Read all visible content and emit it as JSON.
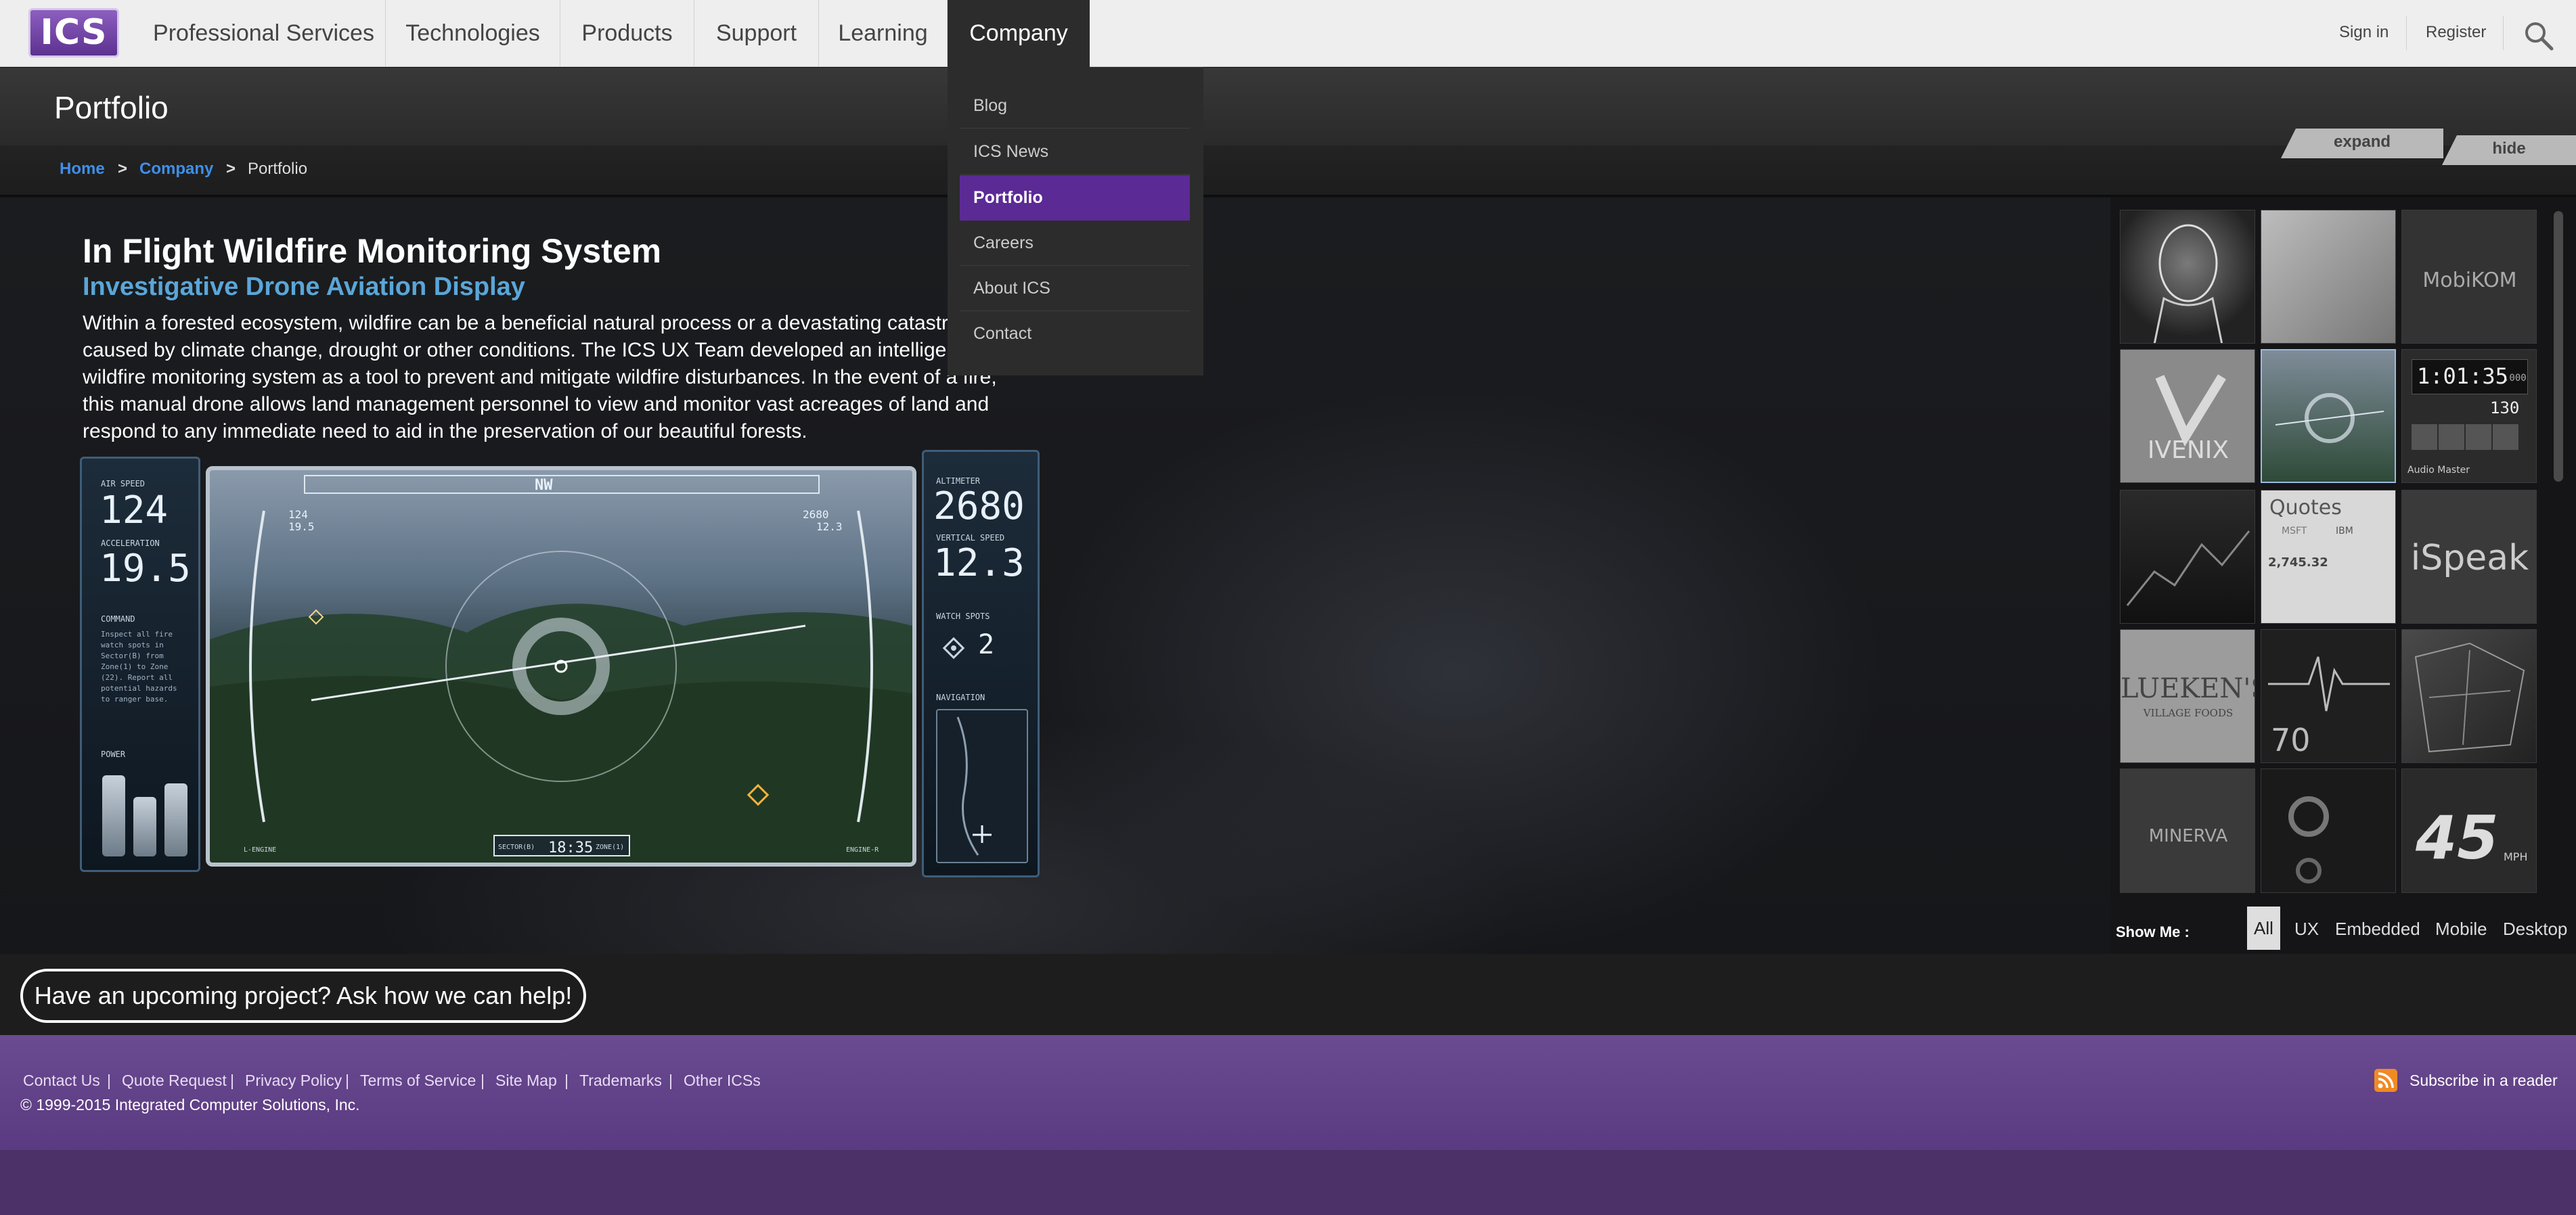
{
  "nav": {
    "logo": "ICS",
    "items": [
      {
        "label": "Professional Services"
      },
      {
        "label": "Technologies"
      },
      {
        "label": "Products"
      },
      {
        "label": "Support"
      },
      {
        "label": "Learning"
      },
      {
        "label": "Company"
      }
    ],
    "sign_in": "Sign in",
    "register": "Register"
  },
  "dropdown": {
    "items": [
      {
        "label": "Blog"
      },
      {
        "label": "ICS News"
      },
      {
        "label": "Portfolio"
      },
      {
        "label": "Careers"
      },
      {
        "label": "About ICS"
      },
      {
        "label": "Contact"
      }
    ]
  },
  "page": {
    "title": "Portfolio",
    "breadcrumb": {
      "home": "Home",
      "sep": ">",
      "company": "Company",
      "current": "Portfolio"
    },
    "expand": "expand",
    "hide": "hide"
  },
  "hero": {
    "title": "In Flight Wildfire Monitoring System",
    "subtitle": "Investigative Drone Aviation Display",
    "description": "Within a forested ecosystem, wildfire can be a beneficial natural process or a devastating catastrophe caused by climate change, drought or other conditions. The ICS UX Team developed an intelligent wildfire monitoring system as a tool to prevent and mitigate wildfire disturbances. In the event of a fire, this manual drone allows land management personnel to view and monitor vast acreages of land and respond to any immediate need to aid in the preservation of our beautiful forests."
  },
  "hud": {
    "air_speed_label": "AIR SPEED",
    "air_speed": "124",
    "accel_label": "ACCELERATION",
    "accel": "19.5",
    "command_label": "COMMAND",
    "command_text": "Inspect all fire watch spots in Sector(B) from Zone(1) to Zone (22). Report all potential hazards to ranger base.",
    "power_label": "POWER",
    "altimeter_label": "ALTIMETER",
    "altimeter": "2680",
    "vert_speed_label": "VERTICAL SPEED",
    "vert_speed": "12.3",
    "watch_label": "WATCH SPOTS",
    "watch_count": "2",
    "nav_label": "NAVIGATION",
    "heading": "NW",
    "tl_a": "124",
    "tl_b": "19.5",
    "tr_a": "2680",
    "tr_b": "12.3",
    "time": "18:35",
    "sector": "SECTOR(B)",
    "zone": "ZONE(1)",
    "engine_l": "L-ENGINE",
    "engine_r": "ENGINE-R"
  },
  "thumbs": {
    "mobikom": "MobiKOM",
    "ivenix": "IVENIX",
    "clock": "1:01:35",
    "clock_ms": ".000",
    "clock_sub": "130",
    "audio": "Audio Master",
    "quotes": "Quotes",
    "quote_a": "MSFT",
    "quote_b": "IBM",
    "quote_val": "2,745.32",
    "ispeak": "iSpeak",
    "luekens": "LUEKEN'S",
    "luekens_sub": "VILLAGE FOODS",
    "ecg_val": "70",
    "minerva": "MINERVA",
    "speed": "45",
    "speed_unit": "MPH"
  },
  "filters": {
    "label": "Show Me :",
    "items": [
      {
        "label": "All"
      },
      {
        "label": "UX"
      },
      {
        "label": "Embedded"
      },
      {
        "label": "Mobile"
      },
      {
        "label": "Desktop"
      }
    ]
  },
  "cta": "Have an upcoming project? Ask how we can help!",
  "footer": {
    "links": [
      {
        "label": "Contact Us"
      },
      {
        "label": "Quote Request"
      },
      {
        "label": "Privacy Policy"
      },
      {
        "label": "Terms of Service"
      },
      {
        "label": "Site Map"
      },
      {
        "label": "Trademarks"
      },
      {
        "label": "Other ICSs"
      }
    ],
    "sep": "|",
    "copyright": "© 1999-2015 Integrated Computer Solutions, Inc.",
    "subscribe": "Subscribe in a reader"
  },
  "colors": {
    "brand_purple": "#5b2a95",
    "link_blue": "#3f8fe8",
    "subtitle_blue": "#5aa6d8",
    "rss_orange": "#f08a24"
  }
}
